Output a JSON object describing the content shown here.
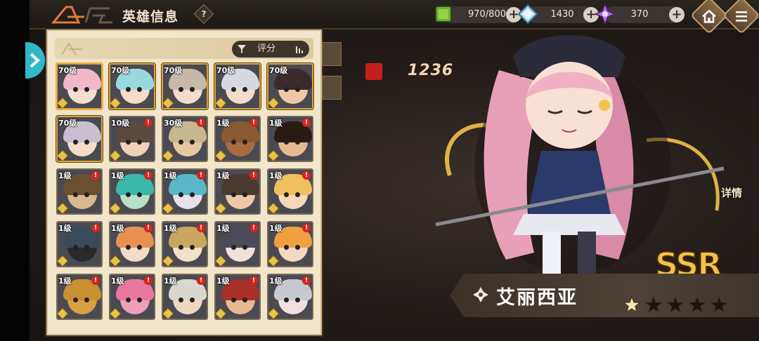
{
  "header": {
    "title": "英雄信息",
    "help": "?"
  },
  "resources": [
    {
      "icon": "stamina-cube-icon",
      "value": "970/800",
      "color": "#6fb03a"
    },
    {
      "icon": "blue-crystal-icon",
      "value": "1430",
      "color": "#a8d8f0"
    },
    {
      "icon": "purple-crystal-icon",
      "value": "370",
      "color": "#b070e0"
    }
  ],
  "sort": {
    "label": "评分"
  },
  "heroes": [
    {
      "level": "70级",
      "badge": "",
      "hair": "#f0b8c8",
      "skin": "#f8dcd0",
      "sel": true,
      "gold": true
    },
    {
      "level": "70级",
      "badge": "",
      "hair": "#9ad8e0",
      "skin": "#f5dcc8",
      "sel": false,
      "gold": true
    },
    {
      "level": "70级",
      "badge": "",
      "hair": "#c8b8a8",
      "skin": "#f5dcc8",
      "sel": false,
      "gold": true
    },
    {
      "level": "70级",
      "badge": "",
      "hair": "#d8d8e0",
      "skin": "#f5dcc8",
      "sel": false,
      "gold": true
    },
    {
      "level": "70级",
      "badge": "",
      "hair": "#3a2a2a",
      "skin": "#f0c8a8",
      "sel": false,
      "gold": true
    },
    {
      "level": "70级",
      "badge": "",
      "hair": "#c8c0d0",
      "skin": "#f5dcc8",
      "sel": false,
      "gold": true
    },
    {
      "level": "10级",
      "badge": "!",
      "hair": "#5a4a40",
      "skin": "#f0d0b8",
      "sel": false,
      "gold": false
    },
    {
      "level": "30级",
      "badge": "!",
      "hair": "#c8b890",
      "skin": "#e8c8a0",
      "sel": false,
      "gold": false
    },
    {
      "level": "1级",
      "badge": "!",
      "hair": "#8a5a30",
      "skin": "#a86a40",
      "sel": false,
      "gold": false
    },
    {
      "level": "1级",
      "badge": "!",
      "hair": "#2a1a14",
      "skin": "#e8b890",
      "sel": false,
      "gold": false
    },
    {
      "level": "1级",
      "badge": "!",
      "hair": "#6a5030",
      "skin": "#d8b890",
      "sel": false,
      "gold": false
    },
    {
      "level": "1级",
      "badge": "!",
      "hair": "#3ab8a8",
      "skin": "#b8e0c8",
      "sel": false,
      "gold": false
    },
    {
      "level": "1级",
      "badge": "!",
      "hair": "#58b8c8",
      "skin": "#e8e0e8",
      "sel": false,
      "gold": false
    },
    {
      "level": "1级",
      "badge": "!",
      "hair": "#4a3a30",
      "skin": "#f0c8a8",
      "sel": false,
      "gold": false
    },
    {
      "level": "1级",
      "badge": "!",
      "hair": "#f0c060",
      "skin": "#f5d8b8",
      "sel": false,
      "gold": false
    },
    {
      "level": "1级",
      "badge": "!",
      "hair": "#3a4a5a",
      "skin": "#2a2a2a",
      "sel": false,
      "gold": false
    },
    {
      "level": "1级",
      "badge": "!",
      "hair": "#e89050",
      "skin": "#f5dcc8",
      "sel": false,
      "gold": false
    },
    {
      "level": "1级",
      "badge": "!",
      "hair": "#c8a860",
      "skin": "#f5e0c8",
      "sel": false,
      "gold": false
    },
    {
      "level": "1级",
      "badge": "!",
      "hair": "#4a4a58",
      "skin": "#f0e0d8",
      "sel": false,
      "gold": false
    },
    {
      "level": "1级",
      "badge": "!",
      "hair": "#f0a040",
      "skin": "#f5d8c0",
      "sel": false,
      "gold": false
    },
    {
      "level": "1级",
      "badge": "!",
      "hair": "#c89030",
      "skin": "#d8a040",
      "sel": false,
      "gold": false
    },
    {
      "level": "1级",
      "badge": "!",
      "hair": "#e878a0",
      "skin": "#f0a0b8",
      "sel": false,
      "gold": false
    },
    {
      "level": "1级",
      "badge": "!",
      "hair": "#d8d8d0",
      "skin": "#f0d8c0",
      "sel": false,
      "gold": false
    },
    {
      "level": "1级",
      "badge": "!",
      "hair": "#a83028",
      "skin": "#e8b890",
      "sel": false,
      "gold": false
    },
    {
      "level": "1级",
      "badge": "!",
      "hair": "#c8c8d0",
      "skin": "#f0e0e0",
      "sel": false,
      "gold": false
    }
  ],
  "hero": {
    "power": "1236",
    "rarity": "SSR",
    "name": "艾丽西亚",
    "stars_filled": 1,
    "stars_total": 5,
    "detail_label": "详情"
  }
}
